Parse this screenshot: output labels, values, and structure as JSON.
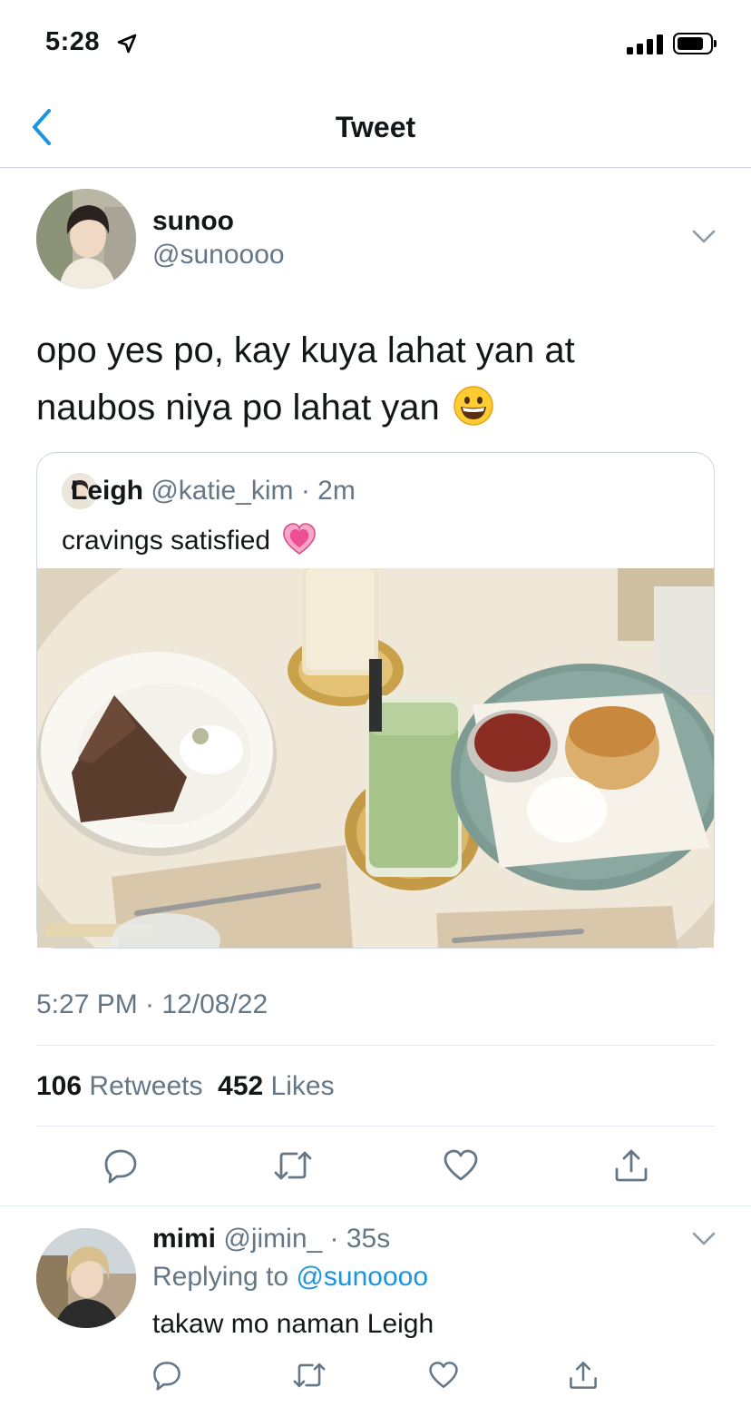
{
  "status_bar": {
    "time": "5:28"
  },
  "nav": {
    "title": "Tweet"
  },
  "tweet": {
    "author_name": "sunoo",
    "author_handle": "@sunoooo",
    "text_line1": "opo yes po, kay kuya lahat yan at",
    "text_line2": "naubos niya po lahat yan",
    "emoji": "grinning-face",
    "timestamp": "5:27 PM · 12/08/22",
    "retweets_count": "106",
    "retweets_label": "Retweets",
    "likes_count": "452",
    "likes_label": "Likes"
  },
  "quote": {
    "name": "Leigh",
    "handle": "@katie_kim",
    "time": "· 2m",
    "text": "cravings satisfied",
    "emoji": "growing-heart"
  },
  "reply": {
    "name": "mimi",
    "handle": "@jimin_",
    "time": "· 35s",
    "replying_prefix": "Replying to",
    "replying_handle": "@sunoooo",
    "text": "takaw mo naman Leigh"
  },
  "colors": {
    "accent": "#1b95e0",
    "secondary_text": "#657786",
    "divider": "#e1e8ed"
  }
}
